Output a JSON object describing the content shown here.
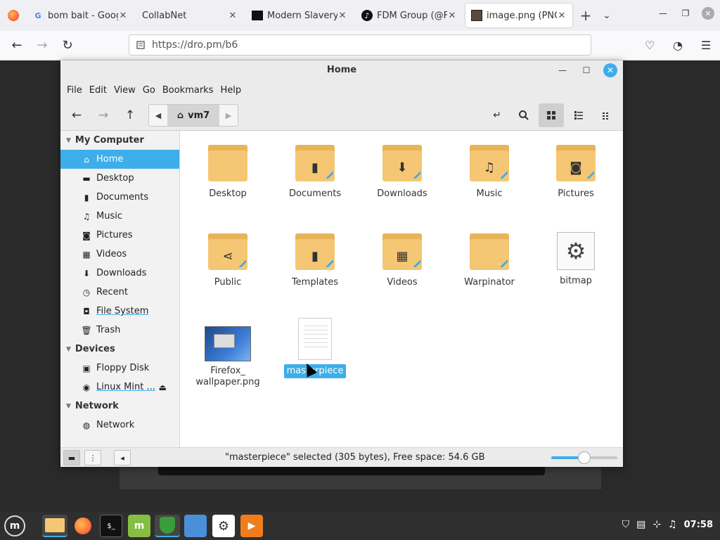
{
  "browser": {
    "tabs": [
      {
        "title": "bom bait - Goog",
        "favicon": "G"
      },
      {
        "title": "CollabNet",
        "favicon": ""
      },
      {
        "title": "Modern Slavery",
        "favicon": ""
      },
      {
        "title": "FDM Group (@F",
        "favicon": "♪"
      },
      {
        "title": "image.png (PNG",
        "favicon": ""
      }
    ],
    "url": "https://dro.pm/b6"
  },
  "filemanager": {
    "window_title": "Home",
    "menu": [
      "File",
      "Edit",
      "Go",
      "View",
      "Bookmarks",
      "Help"
    ],
    "path_crumb": "vm7",
    "sidebar": {
      "sections": [
        {
          "title": "My Computer",
          "items": [
            {
              "label": "Home",
              "icon": "home-icon"
            },
            {
              "label": "Desktop",
              "icon": "desktop-icon"
            },
            {
              "label": "Documents",
              "icon": "documents-icon"
            },
            {
              "label": "Music",
              "icon": "music-icon"
            },
            {
              "label": "Pictures",
              "icon": "camera-icon"
            },
            {
              "label": "Videos",
              "icon": "film-icon"
            },
            {
              "label": "Downloads",
              "icon": "download-icon"
            },
            {
              "label": "Recent",
              "icon": "clock-icon"
            },
            {
              "label": "File System",
              "icon": "drive-icon"
            },
            {
              "label": "Trash",
              "icon": "trash-icon"
            }
          ]
        },
        {
          "title": "Devices",
          "items": [
            {
              "label": "Floppy Disk",
              "icon": "floppy-icon"
            },
            {
              "label": "Linux Mint ...",
              "icon": "disc-icon"
            }
          ]
        },
        {
          "title": "Network",
          "items": [
            {
              "label": "Network",
              "icon": "network-icon"
            }
          ]
        }
      ]
    },
    "files": [
      {
        "name": "Desktop"
      },
      {
        "name": "Documents"
      },
      {
        "name": "Downloads"
      },
      {
        "name": "Music"
      },
      {
        "name": "Pictures"
      },
      {
        "name": "Public"
      },
      {
        "name": "Templates"
      },
      {
        "name": "Videos"
      },
      {
        "name": "Warpinator"
      },
      {
        "name": "bitmap"
      },
      {
        "name": "Firefox_",
        "name2": "wallpaper.png"
      },
      {
        "name": "masterpiece"
      }
    ],
    "status": "\"masterpiece\" selected (305 bytes), Free space: 54.6 GB",
    "zoom_level": 0.5
  },
  "taskbar": {
    "clock": "07:58"
  },
  "colors": {
    "accent": "#3daee9",
    "folder": "#f5c673"
  }
}
